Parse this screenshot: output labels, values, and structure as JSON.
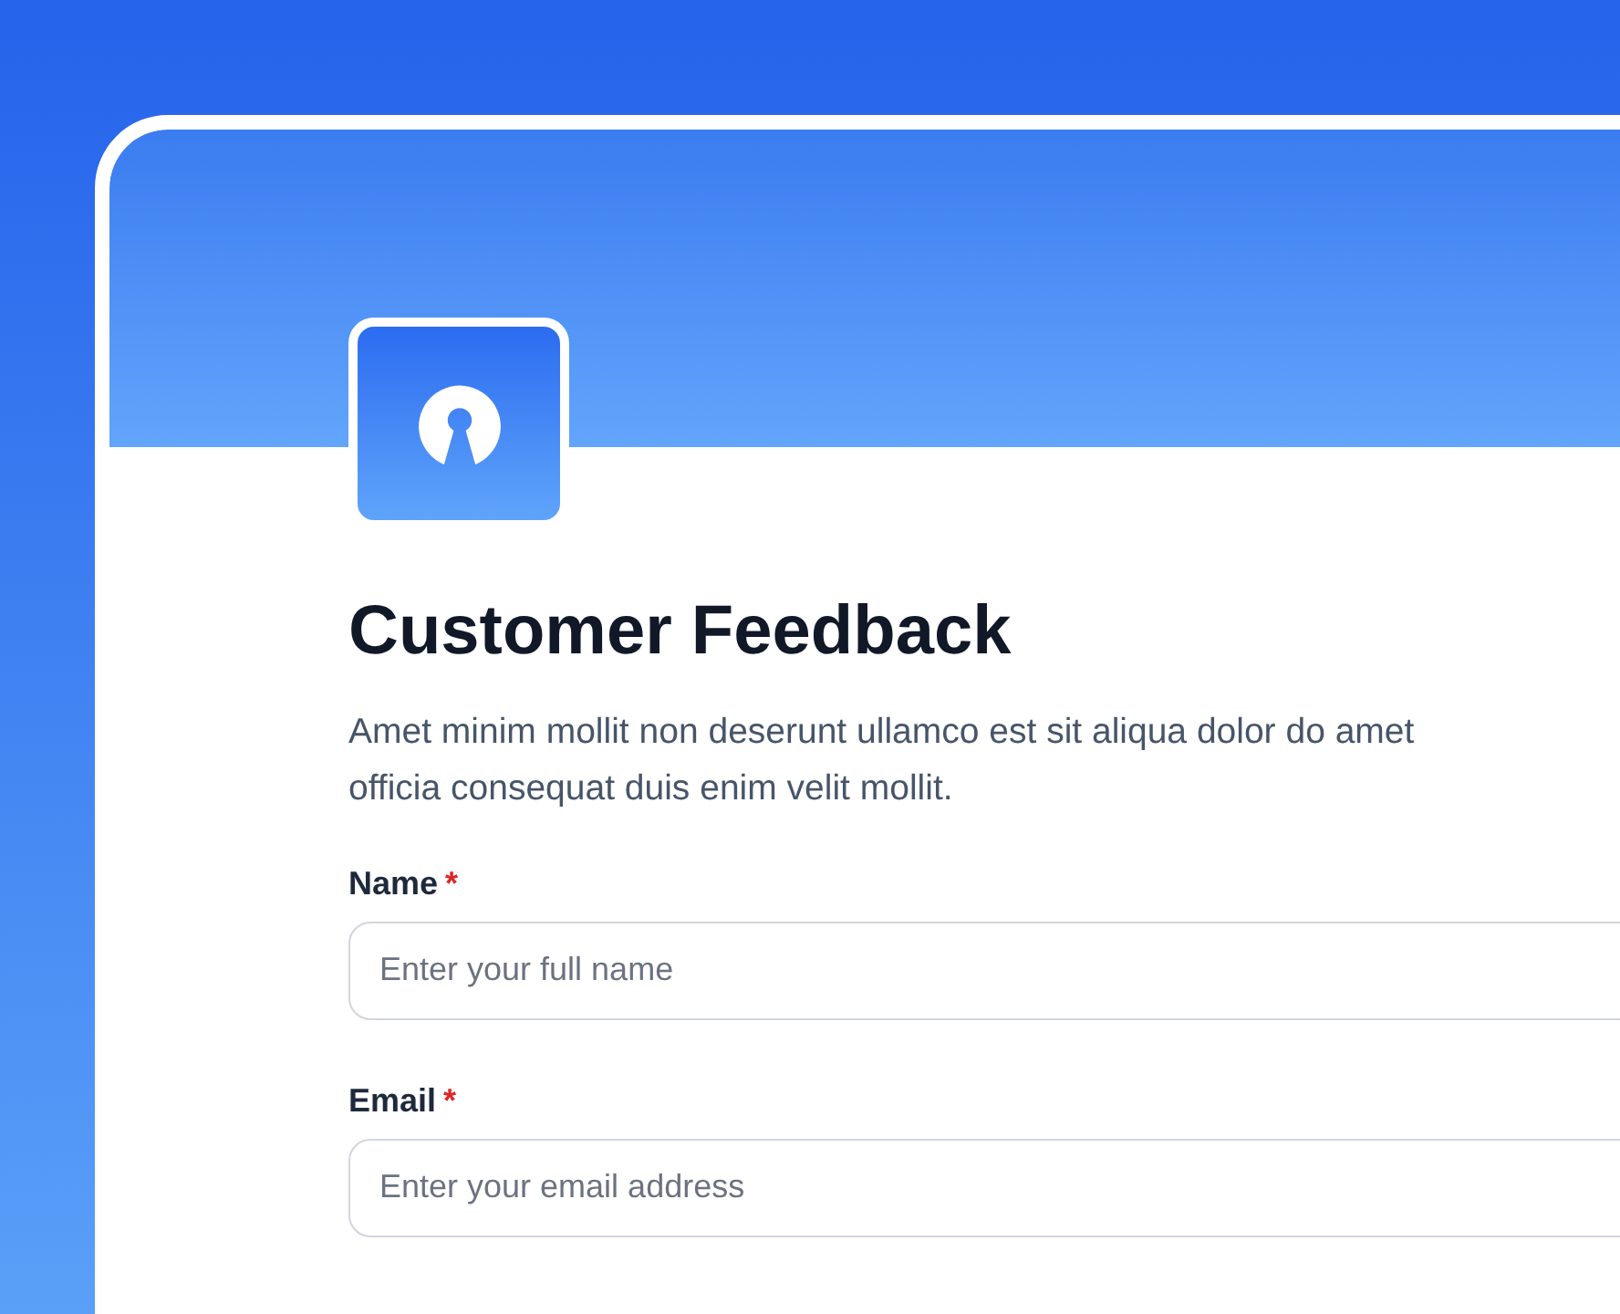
{
  "form": {
    "title": "Customer Feedback",
    "description_lines": [
      "Amet minim mollit non deserunt ullamco est sit aliqua dolor do amet",
      "officia consequat duis enim velit mollit."
    ],
    "fields": [
      {
        "label": "Name",
        "required_mark": "*",
        "placeholder": "Enter your full name"
      },
      {
        "label": "Email",
        "required_mark": "*",
        "placeholder": "Enter your email address"
      }
    ]
  }
}
